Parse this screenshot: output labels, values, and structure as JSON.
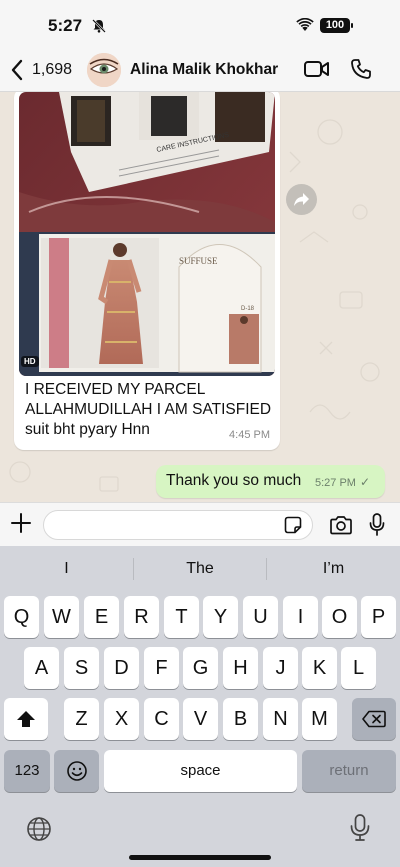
{
  "status_bar": {
    "time": "5:27",
    "battery": "100"
  },
  "header": {
    "back_count": "1,698",
    "contact_name": "Alina Malik Khokhar"
  },
  "messages": [
    {
      "direction": "incoming",
      "type": "image_with_caption",
      "image_badge": "HD",
      "image_caption_text": "CARE INSTRUCTIONS",
      "image_brand_text": "SUFFUSE",
      "image_code_text": "D-18",
      "text_lines": [
        "I RECEIVED MY PARCEL",
        "ALLAHMUDILLAH I AM SATISFIED",
        "suit bht pyary Hnn"
      ],
      "time": "4:45 PM"
    },
    {
      "direction": "outgoing",
      "text": "Thank you so much",
      "time": "5:27 PM",
      "status": "✓"
    }
  ],
  "input": {
    "placeholder": ""
  },
  "keyboard": {
    "suggestions": [
      "I",
      "The",
      "I’m"
    ],
    "row1": [
      "Q",
      "W",
      "E",
      "R",
      "T",
      "Y",
      "U",
      "I",
      "O",
      "P"
    ],
    "row2": [
      "A",
      "S",
      "D",
      "F",
      "G",
      "H",
      "J",
      "K",
      "L"
    ],
    "row3": [
      "Z",
      "X",
      "C",
      "V",
      "B",
      "N",
      "M"
    ],
    "numbers_key": "123",
    "space_key": "space",
    "return_key": "return"
  },
  "icons": [
    "bell-slash-icon",
    "wifi-icon",
    "chevron-left-icon",
    "video-camera-icon",
    "phone-icon",
    "forward-icon",
    "plus-icon",
    "sticker-icon",
    "camera-icon",
    "microphone-icon",
    "shift-icon",
    "backspace-icon",
    "emoji-icon",
    "globe-icon"
  ],
  "colors": {
    "outgoing_bubble": "#d7f5c3",
    "incoming_bubble": "#ffffff",
    "chat_background": "#ece5dc",
    "keyboard": "#d3d5db"
  }
}
